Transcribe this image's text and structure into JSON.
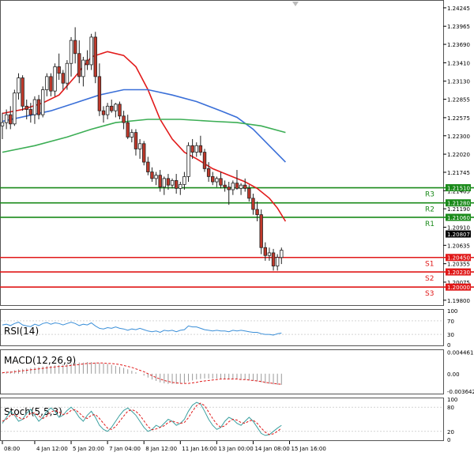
{
  "chart_data": {
    "type": "candlestick",
    "symbol_title": "",
    "colors": {
      "bull_body": "#ffffff",
      "bear_body": "#c0392b",
      "candle_outline": "#222222",
      "ma_red": "#e21b1b",
      "ma_blue": "#3a6fd8",
      "ma_green": "#3cae55",
      "resistance": "#1a8a1a",
      "support": "#e01818",
      "rsi_line": "#3b8fd8",
      "macd_hist": "#999999",
      "macd_signal": "#e01818",
      "stoch_main": "#3aa0a0",
      "stoch_signal": "#e01818",
      "grid": "#dddddd",
      "axis": "#000000"
    },
    "price_axis": {
      "ylim": [
        1.1975,
        1.2434
      ],
      "ticks": [
        "1.24245",
        "1.23965",
        "1.23690",
        "1.23410",
        "1.23130",
        "1.22855",
        "1.22575",
        "1.22300",
        "1.22020",
        "1.21745",
        "1.21465",
        "1.21190",
        "1.20910",
        "1.20635",
        "1.20355",
        "1.20075",
        "1.19800"
      ]
    },
    "x_axis": {
      "labels": [
        "08:00",
        "4 Jan 12:00",
        "5 Jan 20:00",
        "7 Jan 04:00",
        "8 Jan 12:00",
        "11 Jan 16:00",
        "13 Jan 00:00",
        "14 Jan 08:00",
        "15 Jan 16:00"
      ],
      "label_candle_index": [
        0,
        8,
        17,
        26,
        35,
        44,
        53,
        62,
        71
      ]
    },
    "candles": [
      [
        1.2245,
        1.2265,
        1.2225,
        1.225
      ],
      [
        1.225,
        1.227,
        1.224,
        1.2262
      ],
      [
        1.2262,
        1.2275,
        1.224,
        1.2248
      ],
      [
        1.2248,
        1.23,
        1.2245,
        1.2295
      ],
      [
        1.2295,
        1.2325,
        1.2285,
        1.2318
      ],
      [
        1.2318,
        1.2322,
        1.2268,
        1.2275
      ],
      [
        1.2275,
        1.2285,
        1.2255,
        1.227
      ],
      [
        1.227,
        1.228,
        1.225,
        1.2262
      ],
      [
        1.2262,
        1.229,
        1.2248,
        1.2285
      ],
      [
        1.2285,
        1.2292,
        1.2255,
        1.2262
      ],
      [
        1.2262,
        1.2305,
        1.2258,
        1.23
      ],
      [
        1.23,
        1.2325,
        1.229,
        1.232
      ],
      [
        1.232,
        1.2325,
        1.229,
        1.2298
      ],
      [
        1.2298,
        1.234,
        1.229,
        1.2335
      ],
      [
        1.2335,
        1.2355,
        1.2315,
        1.2325
      ],
      [
        1.2325,
        1.233,
        1.23,
        1.231
      ],
      [
        1.231,
        1.2345,
        1.23,
        1.234
      ],
      [
        1.234,
        1.238,
        1.232,
        1.2375
      ],
      [
        1.2375,
        1.2395,
        1.234,
        1.2355
      ],
      [
        1.2355,
        1.2375,
        1.231,
        1.232
      ],
      [
        1.232,
        1.235,
        1.2305,
        1.2345
      ],
      [
        1.2345,
        1.236,
        1.233,
        1.2338
      ],
      [
        1.2338,
        1.2385,
        1.233,
        1.238
      ],
      [
        1.238,
        1.2388,
        1.231,
        1.232
      ],
      [
        1.232,
        1.234,
        1.226,
        1.2268
      ],
      [
        1.2268,
        1.2275,
        1.225,
        1.2262
      ],
      [
        1.2262,
        1.228,
        1.2255,
        1.2275
      ],
      [
        1.2275,
        1.2285,
        1.2265,
        1.2268
      ],
      [
        1.2268,
        1.228,
        1.2258,
        1.2278
      ],
      [
        1.2278,
        1.2282,
        1.2255,
        1.226
      ],
      [
        1.226,
        1.2268,
        1.224,
        1.225
      ],
      [
        1.225,
        1.2262,
        1.2225,
        1.2228
      ],
      [
        1.2228,
        1.224,
        1.222,
        1.2235
      ],
      [
        1.2235,
        1.224,
        1.22,
        1.221
      ],
      [
        1.221,
        1.2225,
        1.2195,
        1.2218
      ],
      [
        1.2218,
        1.2222,
        1.2185,
        1.219
      ],
      [
        1.219,
        1.2198,
        1.217,
        1.2175
      ],
      [
        1.2175,
        1.2182,
        1.216,
        1.2165
      ],
      [
        1.2165,
        1.2175,
        1.2155,
        1.217
      ],
      [
        1.217,
        1.2178,
        1.2145,
        1.2152
      ],
      [
        1.2152,
        1.2168,
        1.214,
        1.2165
      ],
      [
        1.2165,
        1.2172,
        1.2148,
        1.2155
      ],
      [
        1.2155,
        1.2165,
        1.215,
        1.2162
      ],
      [
        1.2162,
        1.2172,
        1.2142,
        1.215
      ],
      [
        1.215,
        1.216,
        1.214,
        1.2156
      ],
      [
        1.2156,
        1.2175,
        1.2148,
        1.2168
      ],
      [
        1.2168,
        1.222,
        1.216,
        1.2215
      ],
      [
        1.2215,
        1.2225,
        1.2195,
        1.2205
      ],
      [
        1.2205,
        1.222,
        1.2198,
        1.2215
      ],
      [
        1.2215,
        1.223,
        1.22,
        1.2205
      ],
      [
        1.2205,
        1.221,
        1.2175,
        1.218
      ],
      [
        1.218,
        1.219,
        1.216,
        1.2168
      ],
      [
        1.2168,
        1.2175,
        1.2155,
        1.216
      ],
      [
        1.216,
        1.2168,
        1.2152,
        1.2165
      ],
      [
        1.2165,
        1.2175,
        1.215,
        1.2155
      ],
      [
        1.2155,
        1.2162,
        1.2145,
        1.2152
      ],
      [
        1.2152,
        1.216,
        1.2125,
        1.2148
      ],
      [
        1.2148,
        1.2162,
        1.214,
        1.2158
      ],
      [
        1.2158,
        1.2178,
        1.2148,
        1.215
      ],
      [
        1.215,
        1.2158,
        1.214,
        1.2155
      ],
      [
        1.2155,
        1.2165,
        1.2145,
        1.215
      ],
      [
        1.215,
        1.2155,
        1.213,
        1.2135
      ],
      [
        1.2135,
        1.2142,
        1.211,
        1.2118
      ],
      [
        1.2118,
        1.213,
        1.21,
        1.211
      ],
      [
        1.211,
        1.2118,
        1.205,
        1.206
      ],
      [
        1.206,
        1.2068,
        1.204,
        1.2048
      ],
      [
        1.2048,
        1.206,
        1.204,
        1.2052
      ],
      [
        1.2052,
        1.2058,
        1.2025,
        1.2032
      ],
      [
        1.2032,
        1.205,
        1.2025,
        1.2045
      ],
      [
        1.2045,
        1.206,
        1.2035,
        1.2056
      ]
    ],
    "moving_averages": [
      {
        "color_key": "ma_red",
        "points": [
          [
            0,
            1.2264
          ],
          [
            5,
            1.227
          ],
          [
            10,
            1.228
          ],
          [
            14,
            1.2292
          ],
          [
            18,
            1.232
          ],
          [
            22,
            1.235
          ],
          [
            26,
            1.2358
          ],
          [
            30,
            1.2352
          ],
          [
            33,
            1.2335
          ],
          [
            36,
            1.23
          ],
          [
            39,
            1.2255
          ],
          [
            42,
            1.2225
          ],
          [
            45,
            1.2205
          ],
          [
            48,
            1.2195
          ],
          [
            52,
            1.218
          ],
          [
            56,
            1.217
          ],
          [
            60,
            1.216
          ],
          [
            63,
            1.215
          ],
          [
            66,
            1.2135
          ],
          [
            68,
            1.212
          ],
          [
            70,
            1.21
          ]
        ]
      },
      {
        "color_key": "ma_blue",
        "points": [
          [
            0,
            1.2252
          ],
          [
            6,
            1.226
          ],
          [
            12,
            1.2268
          ],
          [
            18,
            1.228
          ],
          [
            24,
            1.2292
          ],
          [
            30,
            1.23
          ],
          [
            36,
            1.23
          ],
          [
            42,
            1.2292
          ],
          [
            48,
            1.2282
          ],
          [
            54,
            1.2268
          ],
          [
            58,
            1.2258
          ],
          [
            62,
            1.224
          ],
          [
            66,
            1.2215
          ],
          [
            70,
            1.219
          ]
        ]
      },
      {
        "color_key": "ma_green",
        "points": [
          [
            0,
            1.2205
          ],
          [
            8,
            1.2215
          ],
          [
            16,
            1.2228
          ],
          [
            22,
            1.224
          ],
          [
            28,
            1.225
          ],
          [
            36,
            1.2255
          ],
          [
            44,
            1.2255
          ],
          [
            52,
            1.2252
          ],
          [
            58,
            1.225
          ],
          [
            64,
            1.2245
          ],
          [
            70,
            1.2235
          ]
        ]
      }
    ],
    "levels": [
      {
        "label": "R3",
        "value": "1.21510",
        "price": 1.2151,
        "color_key": "resistance"
      },
      {
        "label": "R2",
        "value": "1.21280",
        "price": 1.2128,
        "color_key": "resistance"
      },
      {
        "label": "R1",
        "value": "1.21060",
        "price": 1.2106,
        "color_key": "resistance"
      },
      {
        "label": "S1",
        "value": "1.20450",
        "price": 1.2045,
        "color_key": "support"
      },
      {
        "label": "S2",
        "value": "1.20230",
        "price": 1.2023,
        "color_key": "support"
      },
      {
        "label": "S3",
        "value": "1.20000",
        "price": 1.2,
        "color_key": "support"
      }
    ],
    "current_price": {
      "value": "1.20807",
      "price": 1.20807
    },
    "rsi": {
      "label": "RSI(14)",
      "ticks": [
        "100",
        "70",
        "30",
        "0"
      ],
      "ylim": [
        0,
        100
      ],
      "values": [
        58,
        60,
        56,
        62,
        66,
        58,
        55,
        53,
        60,
        56,
        62,
        65,
        60,
        64,
        62,
        58,
        62,
        66,
        62,
        56,
        60,
        58,
        64,
        55,
        48,
        46,
        50,
        48,
        52,
        48,
        46,
        42,
        46,
        44,
        48,
        44,
        40,
        38,
        40,
        36,
        42,
        40,
        42,
        38,
        42,
        44,
        55,
        52,
        52,
        48,
        44,
        42,
        40,
        42,
        40,
        40,
        38,
        42,
        40,
        42,
        40,
        38,
        36,
        36,
        32,
        30,
        30,
        28,
        32,
        34
      ]
    },
    "macd": {
      "label": "MACD(12,26,9)",
      "ticks": [
        "0.004461",
        "0.00",
        "-0.003642"
      ],
      "ylim": [
        -0.00395,
        0.0047
      ],
      "histogram": [
        0.0003,
        0.0004,
        0.0005,
        0.0007,
        0.0009,
        0.001,
        0.0011,
        0.0012,
        0.0013,
        0.0014,
        0.0015,
        0.0016,
        0.0016,
        0.0017,
        0.0018,
        0.0019,
        0.002,
        0.0021,
        0.0022,
        0.0023,
        0.0023,
        0.0024,
        0.0024,
        0.0023,
        0.0022,
        0.0021,
        0.002,
        0.0018,
        0.0016,
        0.0014,
        0.0012,
        0.0009,
        0.0006,
        0.0003,
        0.0,
        -0.0004,
        -0.0008,
        -0.0012,
        -0.0015,
        -0.0018,
        -0.002,
        -0.0021,
        -0.0021,
        -0.0021,
        -0.002,
        -0.0019,
        -0.0016,
        -0.0014,
        -0.0012,
        -0.0011,
        -0.001,
        -0.001,
        -0.001,
        -0.001,
        -0.001,
        -0.0011,
        -0.0011,
        -0.0012,
        -0.0012,
        -0.0012,
        -0.0013,
        -0.0014,
        -0.0015,
        -0.0016,
        -0.0018,
        -0.002,
        -0.0021,
        -0.0022,
        -0.0023,
        -0.0023
      ],
      "signal": [
        0.0002,
        0.0003,
        0.0003,
        0.0004,
        0.0005,
        0.0006,
        0.0007,
        0.0008,
        0.0009,
        0.001,
        0.0011,
        0.0012,
        0.0013,
        0.0014,
        0.0015,
        0.0015,
        0.0016,
        0.0017,
        0.0018,
        0.0019,
        0.002,
        0.0021,
        0.0021,
        0.0022,
        0.0022,
        0.0022,
        0.0021,
        0.0021,
        0.002,
        0.0019,
        0.0017,
        0.0015,
        0.0013,
        0.001,
        0.0007,
        0.0004,
        0.0,
        -0.0004,
        -0.0008,
        -0.0011,
        -0.0014,
        -0.0016,
        -0.0018,
        -0.0019,
        -0.002,
        -0.002,
        -0.002,
        -0.0019,
        -0.0018,
        -0.0016,
        -0.0015,
        -0.0014,
        -0.0013,
        -0.0012,
        -0.0011,
        -0.0011,
        -0.0011,
        -0.0011,
        -0.0011,
        -0.0012,
        -0.0012,
        -0.0013,
        -0.0014,
        -0.0015,
        -0.0016,
        -0.0018,
        -0.0019,
        -0.002,
        -0.0021,
        -0.0022
      ]
    },
    "stoch": {
      "label": "Stoch(5,5,3)",
      "ticks": [
        "100",
        "80",
        "20",
        "0"
      ],
      "ylim": [
        0,
        100
      ],
      "main": [
        40,
        55,
        70,
        60,
        45,
        50,
        65,
        75,
        60,
        45,
        55,
        70,
        78,
        70,
        55,
        60,
        72,
        80,
        70,
        55,
        45,
        60,
        70,
        55,
        35,
        25,
        20,
        30,
        45,
        60,
        72,
        78,
        70,
        60,
        45,
        30,
        20,
        25,
        35,
        30,
        40,
        50,
        45,
        35,
        40,
        50,
        70,
        85,
        92,
        88,
        70,
        50,
        35,
        25,
        30,
        45,
        55,
        50,
        40,
        35,
        45,
        55,
        45,
        30,
        15,
        10,
        12,
        20,
        28,
        35
      ],
      "signal": [
        45,
        50,
        60,
        62,
        55,
        50,
        55,
        65,
        66,
        58,
        52,
        58,
        68,
        72,
        68,
        62,
        64,
        72,
        74,
        66,
        56,
        52,
        60,
        62,
        52,
        40,
        28,
        25,
        32,
        45,
        58,
        70,
        74,
        70,
        60,
        46,
        32,
        24,
        26,
        30,
        34,
        42,
        46,
        42,
        40,
        42,
        54,
        70,
        84,
        90,
        84,
        68,
        52,
        38,
        30,
        34,
        44,
        50,
        48,
        42,
        40,
        46,
        48,
        40,
        28,
        18,
        12,
        14,
        20,
        28
      ]
    }
  }
}
